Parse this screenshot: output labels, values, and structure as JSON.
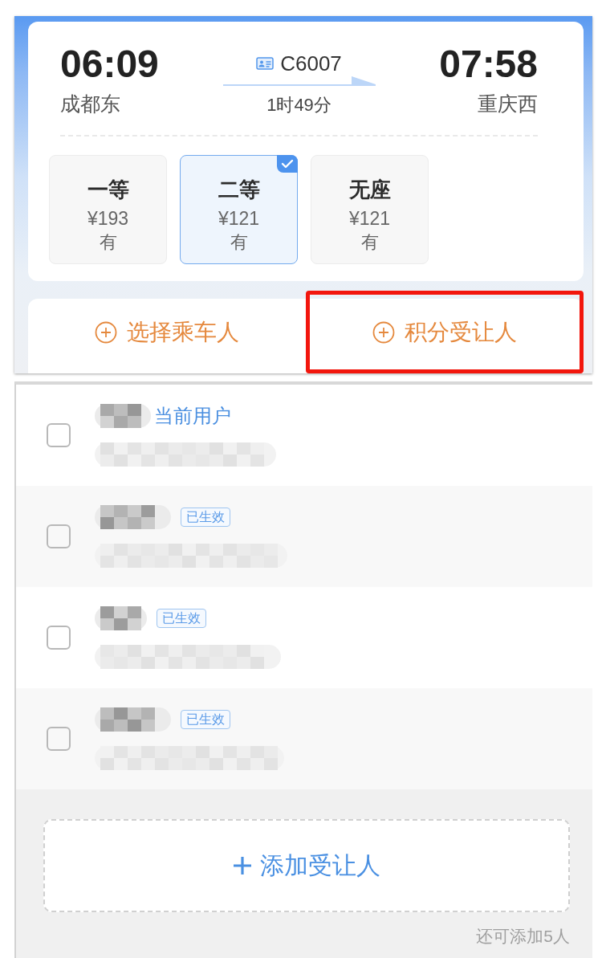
{
  "journey": {
    "depart_time": "06:09",
    "depart_station": "成都东",
    "train_no": "C6007",
    "duration": "1时49分",
    "arrive_time": "07:58",
    "arrive_station": "重庆西"
  },
  "seats": [
    {
      "name": "一等",
      "price": "¥193",
      "availability": "有",
      "selected": false
    },
    {
      "name": "二等",
      "price": "¥121",
      "availability": "有",
      "selected": true
    },
    {
      "name": "无座",
      "price": "¥121",
      "availability": "有",
      "selected": false
    }
  ],
  "actions": [
    {
      "label": "选择乘车人",
      "highlighted": false
    },
    {
      "label": "积分受让人",
      "highlighted": true
    }
  ],
  "people": [
    {
      "kind": "current",
      "tag": "当前用户",
      "checked": false
    },
    {
      "kind": "status",
      "tag": "已生效",
      "checked": false
    },
    {
      "kind": "status",
      "tag": "已生效",
      "checked": false
    },
    {
      "kind": "status",
      "tag": "已生效",
      "checked": false
    }
  ],
  "add_button": {
    "label": "添加受让人"
  },
  "remaining_note": "还可添加5人"
}
